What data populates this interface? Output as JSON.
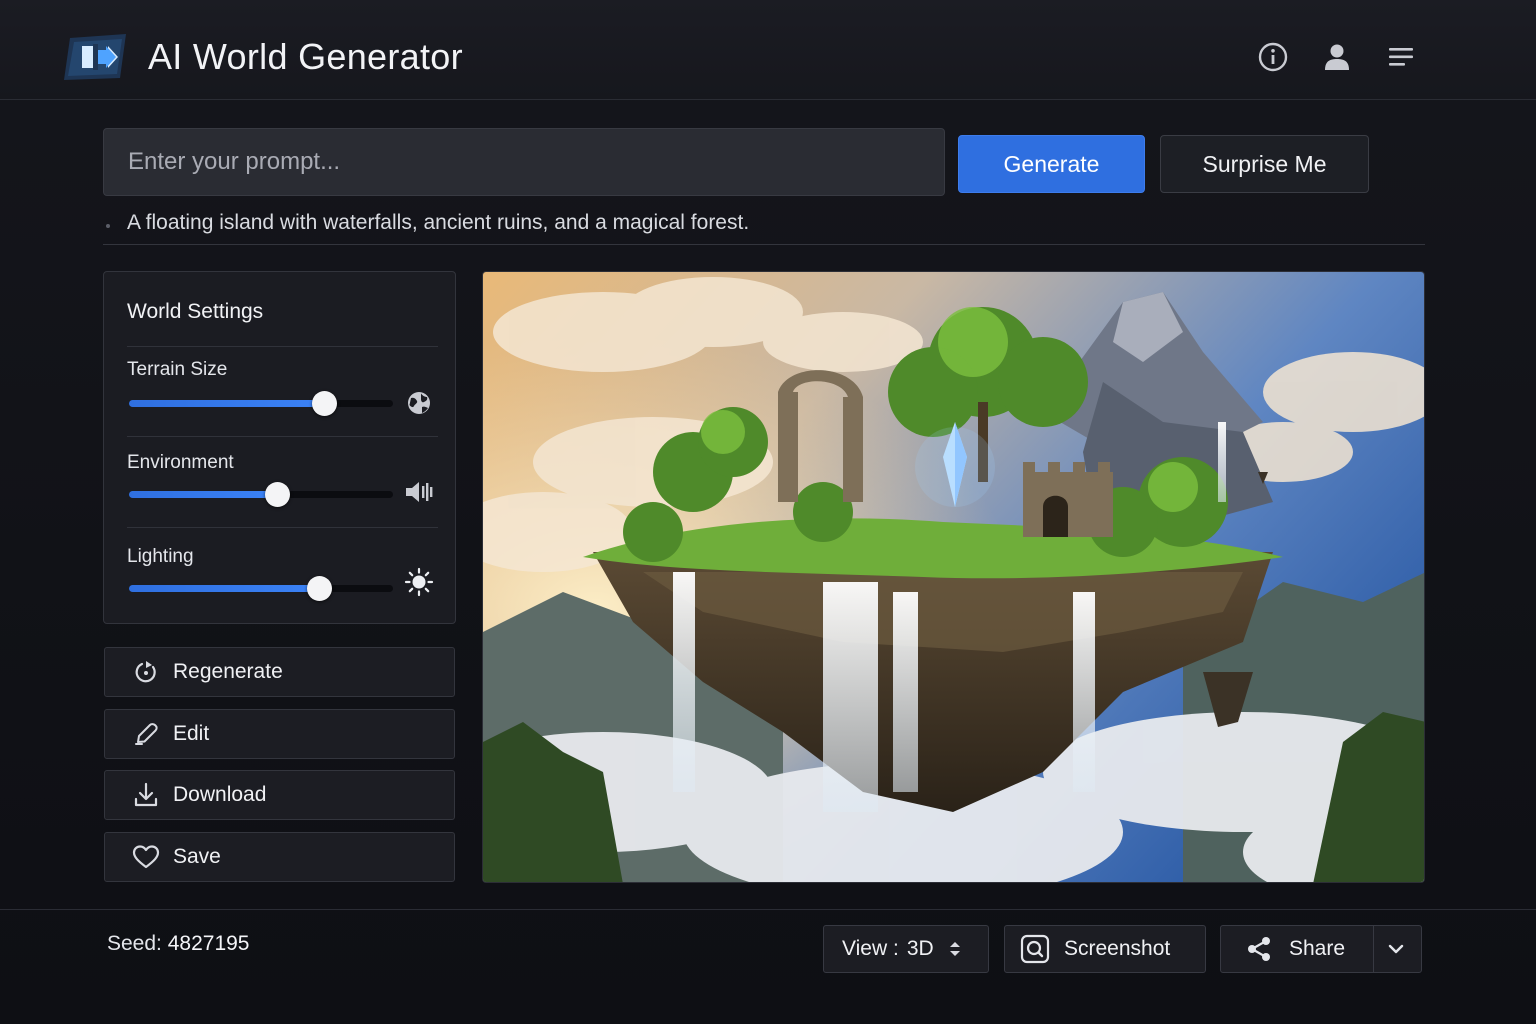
{
  "header": {
    "title": "AI World Generator",
    "icons": [
      "info-icon",
      "user-icon",
      "menu-icon"
    ]
  },
  "prompt": {
    "placeholder": "Enter your prompt...",
    "value": "",
    "generate_label": "Generate",
    "surprise_label": "Surprise Me",
    "current_prompt": "A floating island with waterfalls, ancient ruins, and a magical forest."
  },
  "settings": {
    "title": "World Settings",
    "sliders": [
      {
        "label": "Terrain Size",
        "value": 0.74,
        "icon": "globe-icon"
      },
      {
        "label": "Environment",
        "value": 0.56,
        "icon": "speaker-icon"
      },
      {
        "label": "Lighting",
        "value": 0.72,
        "icon": "sun-icon"
      }
    ]
  },
  "actions": {
    "regenerate": "Regenerate",
    "edit": "Edit",
    "download": "Download",
    "save": "Save"
  },
  "footer": {
    "seed_label": "Seed:",
    "seed_value": "4827195",
    "view_label": "View :",
    "view_value": "3D",
    "screenshot_label": "Screenshot",
    "share_label": "Share"
  },
  "colors": {
    "accent": "#2f6fe0",
    "background": "#121318",
    "panel": "#1b1c22"
  }
}
